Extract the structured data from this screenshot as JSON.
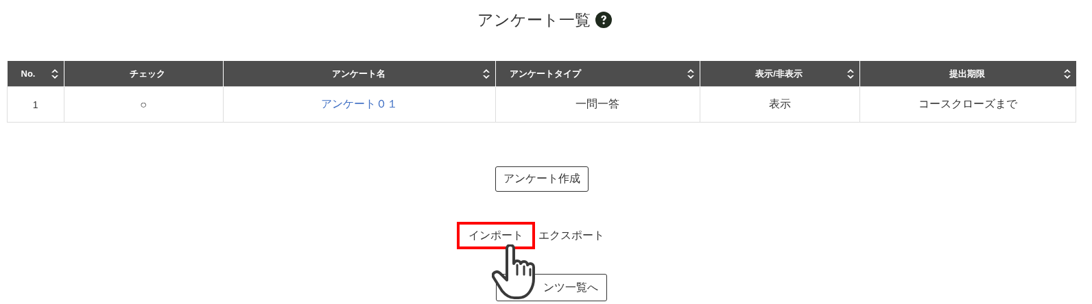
{
  "title": "アンケート一覧",
  "table": {
    "columns": [
      {
        "label": "No.",
        "sortable": true
      },
      {
        "label": "チェック",
        "sortable": false
      },
      {
        "label": "アンケート名",
        "sortable": true
      },
      {
        "label": "アンケートタイプ",
        "sortable": true
      },
      {
        "label": "表示/非表示",
        "sortable": true
      },
      {
        "label": "提出期限",
        "sortable": true
      }
    ],
    "rows": [
      {
        "cells": [
          {
            "text": "1",
            "kind": "text"
          },
          {
            "text": "○",
            "kind": "text"
          },
          {
            "text": "アンケート０１",
            "kind": "link"
          },
          {
            "text": "一問一答",
            "kind": "text"
          },
          {
            "text": "表示",
            "kind": "text"
          },
          {
            "text": "コースクローズまで",
            "kind": "text"
          }
        ]
      }
    ]
  },
  "create_button": "アンケート作成",
  "links": [
    {
      "label": "インポート",
      "highlighted": true
    },
    {
      "label": "エクスポート",
      "highlighted": false
    }
  ],
  "back_button": "ンツ一覧へ"
}
